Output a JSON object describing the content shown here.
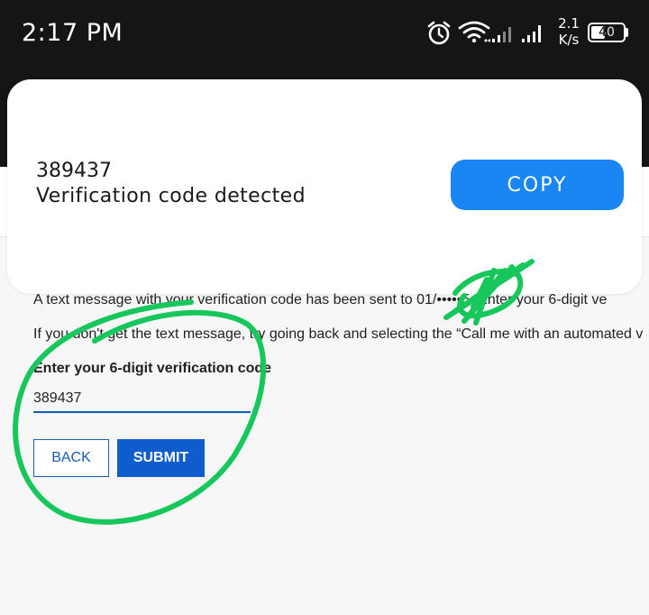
{
  "status_bar": {
    "time": "2:17 PM",
    "net_speed_value": "2.1",
    "net_speed_unit": "K/s",
    "battery_level": "40",
    "icons": [
      "alarm-icon",
      "wifi-icon",
      "signal-icon",
      "signal-icon",
      "battery-icon"
    ]
  },
  "notification": {
    "code": "389437",
    "caption": "Verification code detected",
    "copy_label": "COPY",
    "accent": "#1a86f4"
  },
  "page": {
    "message_line_1": "A text message with your verification code has been sent to 01/•••••5. Enter your 6-digit ve",
    "message_line_2": "If you don't get the text message, try going back and selecting the “Call me with an automated v",
    "input_label": "Enter your 6-digit verification code",
    "input_value": "389437",
    "back_label": "BACK",
    "submit_label": "SUBMIT",
    "primary_color": "#0f5ccd"
  },
  "annotation": {
    "color": "#18c75c"
  }
}
